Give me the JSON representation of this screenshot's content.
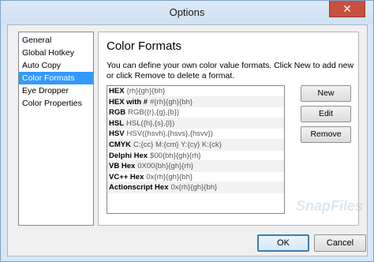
{
  "window": {
    "title": "Options",
    "close_glyph": "✕"
  },
  "sidebar": {
    "items": [
      {
        "label": "General"
      },
      {
        "label": "Global Hotkey"
      },
      {
        "label": "Auto Copy"
      },
      {
        "label": "Color Formats",
        "selected": true
      },
      {
        "label": "Eye Dropper"
      },
      {
        "label": "Color Properties"
      }
    ]
  },
  "panel": {
    "title": "Color Formats",
    "description": "You can define your own color value formats. Click New to add new or click Remove to delete a format."
  },
  "formats": [
    {
      "name": "HEX",
      "pattern": "{rh}{gh}{bh}"
    },
    {
      "name": "HEX with #",
      "pattern": "#{rh}{gh}{bh}"
    },
    {
      "name": "RGB",
      "pattern": "RGB({r},{g},{b})"
    },
    {
      "name": "HSL",
      "pattern": "HSL({h},{s},{l})"
    },
    {
      "name": "HSV",
      "pattern": "HSV({hsvh},{hsvs},{hsvv})"
    },
    {
      "name": "CMYK",
      "pattern": "C:{cc} M:{cm} Y:{cy} K:{ck}"
    },
    {
      "name": "Delphi Hex",
      "pattern": "$00{bh}{gh}{rh}"
    },
    {
      "name": "VB Hex",
      "pattern": "0X00{bh}{gh}{rh}"
    },
    {
      "name": "VC++ Hex",
      "pattern": "0x{rh}{gh}{bh}"
    },
    {
      "name": "Actionscript Hex",
      "pattern": "0x{rh}{gh}{bh}"
    }
  ],
  "buttons": {
    "new": "New",
    "edit": "Edit",
    "remove": "Remove",
    "ok": "OK",
    "cancel": "Cancel"
  },
  "watermark": "SnapFiles",
  "colors": {
    "selection": "#3399ff",
    "close": "#c7503f",
    "titlebar": "#d7e7f6"
  }
}
